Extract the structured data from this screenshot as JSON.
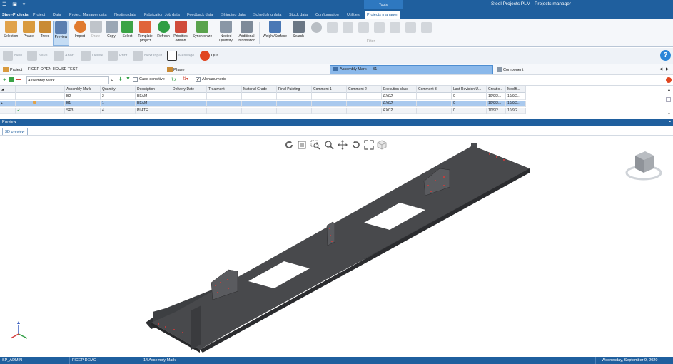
{
  "window": {
    "title": "Steel Projects PLM - Projects manager",
    "context_tab_group": "Tools",
    "quick_access": "☰ ▣ ▾"
  },
  "ribbon_tabs": [
    {
      "label": "Steel-Projects"
    },
    {
      "label": "Project"
    },
    {
      "label": "Data"
    },
    {
      "label": "Project Manager data"
    },
    {
      "label": "Nesting data"
    },
    {
      "label": "Fabrication Job data"
    },
    {
      "label": "Feedback data"
    },
    {
      "label": "Shipping data"
    },
    {
      "label": "Scheduling data"
    },
    {
      "label": "Stock data"
    },
    {
      "label": "Configuration"
    },
    {
      "label": "Utilities"
    },
    {
      "label": "Projects manager"
    }
  ],
  "ribbon": {
    "buttons": [
      {
        "label": "Selection",
        "icon": "selection-icon",
        "color": "#e0a24a"
      },
      {
        "label": "Phase",
        "icon": "phase-icon",
        "color": "#d99a3e"
      },
      {
        "label": "Trees",
        "icon": "trees-icon",
        "color": "#c98b35"
      },
      {
        "label": "Preview",
        "icon": "preview-icon",
        "color": "#5b7fb0"
      },
      {
        "label": "Import",
        "icon": "import-icon",
        "color": "#e07a2e"
      },
      {
        "label": "Draw",
        "icon": "draw-icon",
        "color": "#bfc4ca"
      },
      {
        "label": "Copy",
        "icon": "copy-icon",
        "color": "#9aa7b5"
      },
      {
        "label": "Select",
        "icon": "select-icon",
        "color": "#3aa345"
      },
      {
        "label": "Template project",
        "icon": "template-icon",
        "color": "#e0643a"
      },
      {
        "label": "Refresh",
        "icon": "refresh-icon",
        "color": "#2f9e44"
      },
      {
        "label": "Priorities edition",
        "icon": "priorities-icon",
        "color": "#d04b3b"
      },
      {
        "label": "Synchronize",
        "icon": "synchronize-icon",
        "color": "#5aa34d"
      },
      {
        "label": "Nested Quantity",
        "icon": "nested-quantity-icon",
        "color": "#8a97a6"
      },
      {
        "label": "Additional Information",
        "icon": "additional-info-icon",
        "color": "#7d8a99"
      },
      {
        "label": "Weight/Surface",
        "icon": "weight-surface-icon",
        "color": "#4a78b5"
      },
      {
        "label": "Search",
        "icon": "search-icon",
        "color": "#6b7785"
      }
    ],
    "filter_group_label": "Filter"
  },
  "actions": [
    {
      "label": "New",
      "icon": "new-icon"
    },
    {
      "label": "Save",
      "icon": "save-icon"
    },
    {
      "label": "Abort",
      "icon": "abort-icon"
    },
    {
      "label": "Delete",
      "icon": "delete-icon"
    },
    {
      "label": "Print",
      "icon": "print-icon"
    },
    {
      "label": "Next Input",
      "icon": "next-input-icon"
    },
    {
      "label": "Message",
      "icon": "message-icon"
    },
    {
      "label": "Quit",
      "icon": "quit-icon"
    }
  ],
  "project": {
    "label": "Project",
    "name": "FICEP OPEN HOUSE TEST",
    "phase_label": "Phase",
    "assembly_mark_label": "Assembly Mark",
    "assembly_mark_value": "B1",
    "component_label": "Component"
  },
  "search": {
    "field_value": "Assembly Mark",
    "case_sensitive_label": "Case sensitive",
    "alphanumeric_label": "Alphanumeric",
    "alphanumeric_checked": "✓"
  },
  "grid": {
    "columns": [
      "Assembly Mark",
      "Quantity",
      "Description",
      "Delivery Date",
      "Treatment",
      "Material Grade",
      "Final Painting",
      "Comment 1",
      "Comment 2",
      "Execution class",
      "Comment 3",
      "Last Revision U...",
      "Creatio...",
      "Modifi..."
    ],
    "rows": [
      {
        "mark": "B2",
        "qty": "2",
        "desc": "BEAM",
        "exec": "EXC2",
        "rev": "0",
        "created": "10/9/2...",
        "modified": "10/9/2..."
      },
      {
        "mark": "B1",
        "qty": "1",
        "desc": "BEAM",
        "exec": "EXC2",
        "rev": "0",
        "created": "10/9/2...",
        "modified": "10/9/2..."
      },
      {
        "mark": "SP3",
        "qty": "4",
        "desc": "PLATE",
        "exec": "EXC2",
        "rev": "0",
        "created": "10/9/2...",
        "modified": "10/9/2..."
      }
    ]
  },
  "preview": {
    "panel_title": "Preview",
    "tab_label": "3D preview"
  },
  "status": {
    "user": "SP_ADMIN",
    "company": "FICEP DEMO",
    "count": "14 Assembly Mark",
    "date": "Wednesday, September 9, 2020"
  },
  "colors": {
    "accent": "#1f5f9e",
    "selection": "#a9c9ee",
    "beam": "#3d3f42"
  }
}
